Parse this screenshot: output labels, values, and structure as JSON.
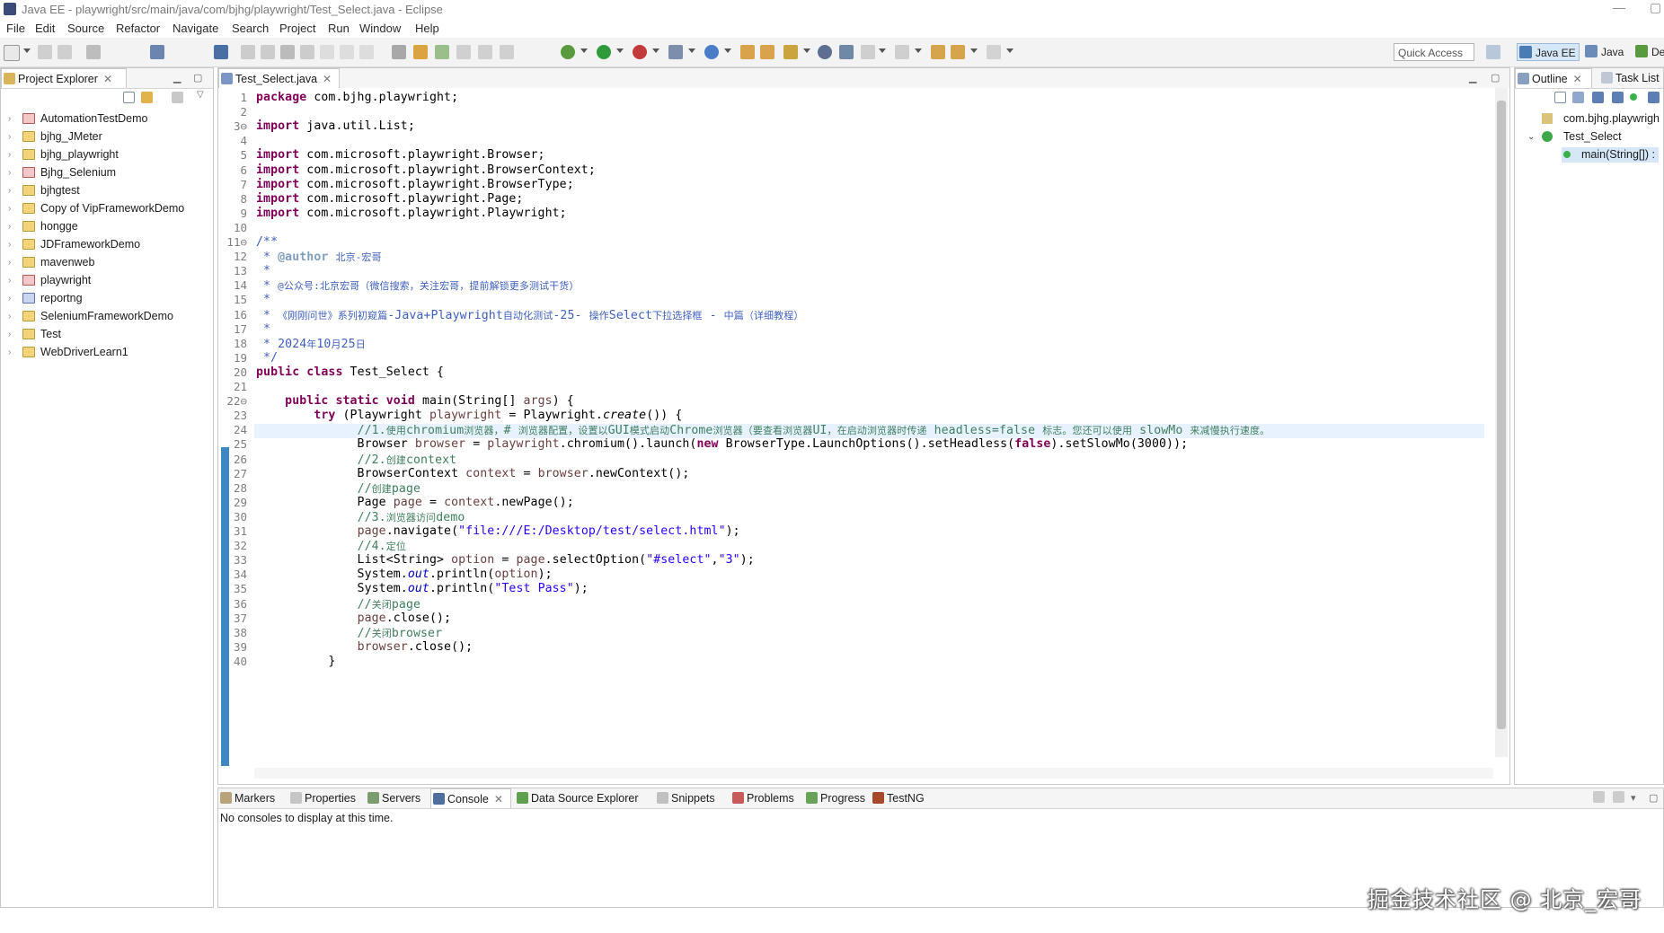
{
  "window": {
    "title": "Java EE - playwright/src/main/java/com/bjhg/playwright/Test_Select.java - Eclipse"
  },
  "menu": [
    "File",
    "Edit",
    "Source",
    "Refactor",
    "Navigate",
    "Search",
    "Project",
    "Run",
    "Window",
    "Help"
  ],
  "toolbar": {
    "quick_access": "Quick Access",
    "perspectives": [
      "Java EE",
      "Java",
      "De"
    ]
  },
  "project_explorer": {
    "tab": "Project Explorer",
    "items": [
      "AutomationTestDemo",
      "bjhg_JMeter",
      "bjhg_playwright",
      "Bjhg_Selenium",
      "bjhgtest",
      "Copy of VipFrameworkDemo",
      "hongge",
      "JDFrameworkDemo",
      "mavenweb",
      "playwright",
      "reportng",
      "SeleniumFrameworkDemo",
      "Test",
      "WebDriverLearn1"
    ]
  },
  "editor": {
    "tab": "Test_Select.java",
    "lines": [
      {
        "n": "1",
        "html": "<span class='kw'>package</span> com.bjhg.playwright;"
      },
      {
        "n": "2",
        "html": ""
      },
      {
        "n": "3⊖",
        "html": "<span class='kw'>import</span> java.util.List;"
      },
      {
        "n": "4",
        "html": ""
      },
      {
        "n": "5",
        "html": "<span class='kw'>import</span> com.microsoft.playwright.Browser;"
      },
      {
        "n": "6",
        "html": "<span class='kw'>import</span> com.microsoft.playwright.BrowserContext;"
      },
      {
        "n": "7",
        "html": "<span class='kw'>import</span> com.microsoft.playwright.BrowserType;"
      },
      {
        "n": "8",
        "html": "<span class='kw'>import</span> com.microsoft.playwright.Page;"
      },
      {
        "n": "9",
        "html": "<span class='kw'>import</span> com.microsoft.playwright.Playwright;"
      },
      {
        "n": "10",
        "html": ""
      },
      {
        "n": "11⊖",
        "html": "<span class='jd'>/**</span>"
      },
      {
        "n": "12",
        "html": "<span class='jd'> * <span style='color:#7f9fbf;font-weight:bold'>@author</span> <span style='font-size:11px'>北京-宏哥</span></span>"
      },
      {
        "n": "13",
        "html": "<span class='jd'> *</span>"
      },
      {
        "n": "14",
        "html": "<span class='jd'> * <span style='font-size:11px'>@公众号:北京宏哥（微信搜索，关注宏哥，提前解锁更多测试干货）</span></span>"
      },
      {
        "n": "15",
        "html": "<span class='jd'> *</span>"
      },
      {
        "n": "16",
        "html": "<span class='jd'> * <span style='font-size:11px'>《刚刚问世》系列初窥篇</span>-Java+Playwright<span style='font-size:11px'>自动化测试</span>-25- <span style='font-size:11px'>操作</span>Select<span style='font-size:11px'>下拉选择框</span> - <span style='font-size:11px'>中篇（详细教程）</span></span>"
      },
      {
        "n": "17",
        "html": "<span class='jd'> *</span>"
      },
      {
        "n": "18",
        "html": "<span class='jd'> * 2024<span style='font-size:11px'>年</span>10<span style='font-size:11px'>月</span>25<span style='font-size:11px'>日</span></span>"
      },
      {
        "n": "19",
        "html": "<span class='jd'> */</span>"
      },
      {
        "n": "20",
        "html": "<span class='kw'>public</span> <span class='kw'>class</span> Test_Select {"
      },
      {
        "n": "21",
        "html": ""
      },
      {
        "n": "22⊖",
        "html": "    <span class='kw'>public</span> <span class='kw'>static</span> <span class='kw'>void</span> main(String[] <span class='var'>args</span>) {"
      },
      {
        "n": "23",
        "html": "        <span class='kw'>try</span> (Playwright <span class='var'>playwright</span> = Playwright.<span class='stat'>create</span>()) {"
      },
      {
        "n": "24",
        "html": "              <span class='cm'>//1.<span style='font-size:11px'>使用</span>chromium<span style='font-size:11px'>浏览器，</span># <span style='font-size:11px'>浏览器配置，设置以</span>GUI<span style='font-size:11px'>模式启动</span>Chrome<span style='font-size:11px'>浏览器（要查看浏览器</span>UI<span style='font-size:11px'>，在启动浏览器时传递</span> headless=false <span style='font-size:11px'>标志。您还可以使用</span> slowMo <span style='font-size:11px'>来减慢执行速度。</span></span>"
      },
      {
        "n": "25",
        "html": "              Browser <span class='var'>browser</span> = <span class='var'>playwright</span>.chromium().launch(<span class='kw'>new</span> BrowserType.LaunchOptions().setHeadless(<span class='kw'>false</span>).setSlowMo(3000));"
      },
      {
        "n": "26",
        "html": "              <span class='cm'>//2.<span style='font-size:11px'>创建</span>context</span>"
      },
      {
        "n": "27",
        "html": "              BrowserContext <span class='var'>context</span> = <span class='var'>browser</span>.newContext();"
      },
      {
        "n": "28",
        "html": "              <span class='cm'>//<span style='font-size:11px'>创建</span>page</span>"
      },
      {
        "n": "29",
        "html": "              Page <span class='var'>page</span> = <span class='var'>context</span>.newPage();"
      },
      {
        "n": "30",
        "html": "              <span class='cm'>//3.<span style='font-size:11px'>浏览器访问</span>demo</span>"
      },
      {
        "n": "31",
        "html": "              <span class='var'>page</span>.navigate(<span class='str'>\"file:///E:/Desktop/test/select.html\"</span>);"
      },
      {
        "n": "32",
        "html": "              <span class='cm'>//4.<span style='font-size:11px'>定位</span></span>"
      },
      {
        "n": "33",
        "html": "              List&lt;String&gt; <span class='var'>option</span> = <span class='var'>page</span>.selectOption(<span class='str'>\"#select\"</span>,<span class='str'>\"3\"</span>);"
      },
      {
        "n": "34",
        "html": "              System.<span class='fld'>out</span>.println(<span class='var'>option</span>);"
      },
      {
        "n": "35",
        "html": "              System.<span class='fld'>out</span>.println(<span class='str'>\"Test Pass\"</span>);"
      },
      {
        "n": "36",
        "html": "              <span class='cm'>//<span style='font-size:11px'>关闭</span>page</span>"
      },
      {
        "n": "37",
        "html": "              <span class='var'>page</span>.close();"
      },
      {
        "n": "38",
        "html": "              <span class='cm'>//<span style='font-size:11px'>关闭</span>browser</span>"
      },
      {
        "n": "39",
        "html": "              <span class='var'>browser</span>.close();"
      },
      {
        "n": "40",
        "html": "          }"
      }
    ]
  },
  "outline": {
    "tabs": [
      "Outline",
      "Task List"
    ],
    "items": [
      "com.bjhg.playwrigh",
      "Test_Select",
      "main(String[]) :"
    ]
  },
  "bottom": {
    "tabs": [
      "Markers",
      "Properties",
      "Servers",
      "Console",
      "Data Source Explorer",
      "Snippets",
      "Problems",
      "Progress",
      "TestNG"
    ],
    "message": "No consoles to display at this time."
  },
  "watermark": "掘金技术社区 @ 北京_宏哥",
  "colors": {
    "keyword": "#7f0055",
    "comment": "#3f7f5f",
    "javadoc": "#3f5fbf",
    "string": "#2a00ff",
    "variable": "#6a3e3e",
    "current_line": "#e8f2fe"
  }
}
